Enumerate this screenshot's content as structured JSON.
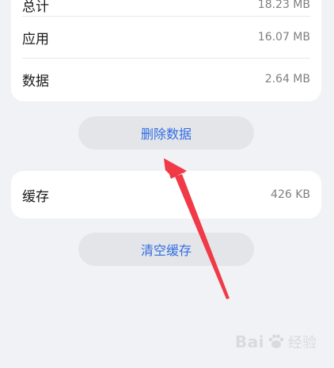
{
  "storage": {
    "rows": [
      {
        "label": "总计",
        "value": "18.23 MB"
      },
      {
        "label": "应用",
        "value": "16.07 MB"
      },
      {
        "label": "数据",
        "value": "2.64 MB"
      }
    ]
  },
  "actions": {
    "delete_data_label": "删除数据",
    "clear_cache_label": "清空缓存"
  },
  "cache": {
    "label": "缓存",
    "value": "426 KB"
  },
  "watermark": {
    "brand": "Bai",
    "brand_tail": "经验"
  },
  "colors": {
    "accent": "#2f6de1",
    "arrow": "#f03a47",
    "background": "#f1f2f5"
  }
}
